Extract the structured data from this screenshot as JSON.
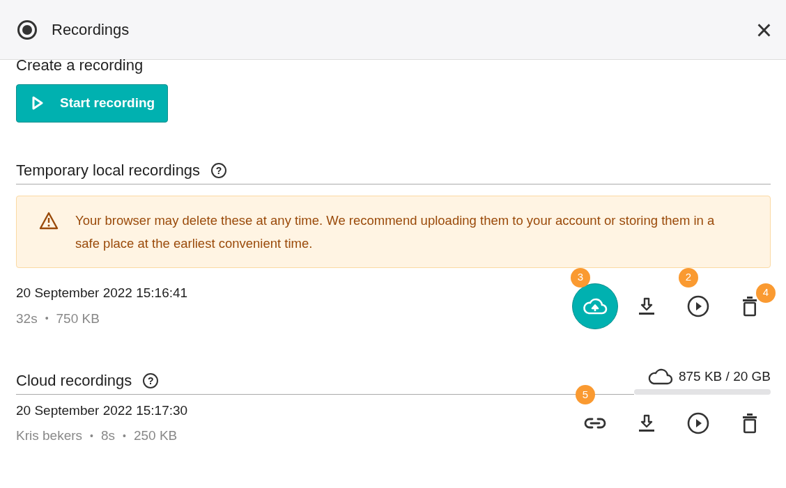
{
  "header": {
    "title": "Recordings",
    "close": "×"
  },
  "create": {
    "heading": "Create a recording",
    "button": "Start recording"
  },
  "local": {
    "heading": "Temporary local recordings",
    "help": "?",
    "alert": "Your browser may delete these at any time. We recommend uploading them to your account or storing them in a safe place at the earliest convenient time.",
    "recordings": [
      {
        "date": "20 September 2022 15:16:41",
        "meta": [
          "32s",
          "750 KB"
        ],
        "separator": "•",
        "actions": [
          {
            "kind": "upload",
            "highlighted": true,
            "callout": "3"
          },
          {
            "kind": "download",
            "highlighted": false
          },
          {
            "kind": "play",
            "highlighted": false,
            "callout": "2"
          },
          {
            "kind": "delete",
            "highlighted": false,
            "callout": "4"
          }
        ]
      }
    ]
  },
  "cloud": {
    "heading": "Cloud recordings",
    "help": "?",
    "storage": {
      "text": "875 KB / 20 GB"
    },
    "recordings": [
      {
        "date": "20 September 2022 15:17:30",
        "meta": [
          "Kris bekers",
          "8s",
          "250 KB"
        ],
        "separator": "•",
        "actions": [
          {
            "kind": "link",
            "highlighted": false,
            "callout": "5"
          },
          {
            "kind": "download",
            "highlighted": false
          },
          {
            "kind": "play",
            "highlighted": false
          },
          {
            "kind": "delete",
            "highlighted": false
          }
        ]
      }
    ]
  }
}
